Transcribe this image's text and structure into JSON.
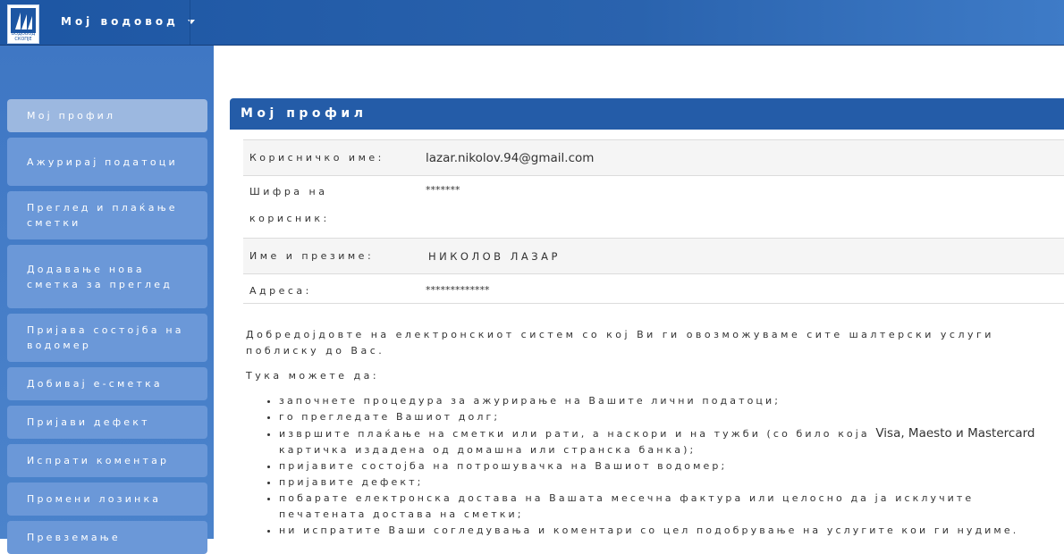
{
  "header": {
    "logo_text": "ВОДОВОД СКОПЈЕ",
    "brand": "Мој водовод",
    "logo_color": "#1d56a3"
  },
  "sidebar": {
    "items": [
      {
        "label": "Мој профил",
        "active": true
      },
      {
        "label": "Ажурирај податоци"
      },
      {
        "label": "Преглед и плаќање сметки"
      },
      {
        "label": "Додавање нова сметка за преглед"
      },
      {
        "label": "Пријава состојба на водомер"
      },
      {
        "label": "Добивај е-сметка"
      },
      {
        "label": "Пријави дефект"
      },
      {
        "label": "Испрати коментар"
      },
      {
        "label": "Промени лозинка"
      },
      {
        "label": "Превземање"
      }
    ]
  },
  "profile": {
    "title": "Мој профил",
    "username_label": "Корисничко име:",
    "username_value": "lazar.nikolov.94@gmail.com",
    "password_label": "Шифра на корисник:",
    "password_value": "*******",
    "name_label": "Име и презиме:",
    "name_value": "НИКОЛОВ ЛАЗАР",
    "address_label": "Адреса:",
    "address_value": "*************"
  },
  "content": {
    "welcome": "Добредојдовте на електронскиот систем со кој Ви ги овозможуваме сите шалтерски услуги поблиску до Вас.",
    "here": "Тука можете да:",
    "options": [
      {
        "pre": "започнете процедура за ажурирање на Вашите лични податоци;"
      },
      {
        "pre": "го прегледате Вашиот долг;"
      },
      {
        "pre": "извршите плаќање на сметки или рати, а наскори и на тужби (со било која ",
        "latin": "Visa, Maesto и Mastercard",
        "post": " картичка издадена од домашна или странска банка);"
      },
      {
        "pre": "пријавите состојба на потрошувачка на Вашиот водомер;"
      },
      {
        "pre": "пријавите дефект;"
      },
      {
        "pre": "побарате електронска достава на Вашата месечна фактура или целосно да ја исклучите печатената достава на сметки;"
      },
      {
        "pre": "ни испратите Ваши согледувања и коментари со цел подобрување на услугите кои ги нудиме."
      }
    ]
  }
}
